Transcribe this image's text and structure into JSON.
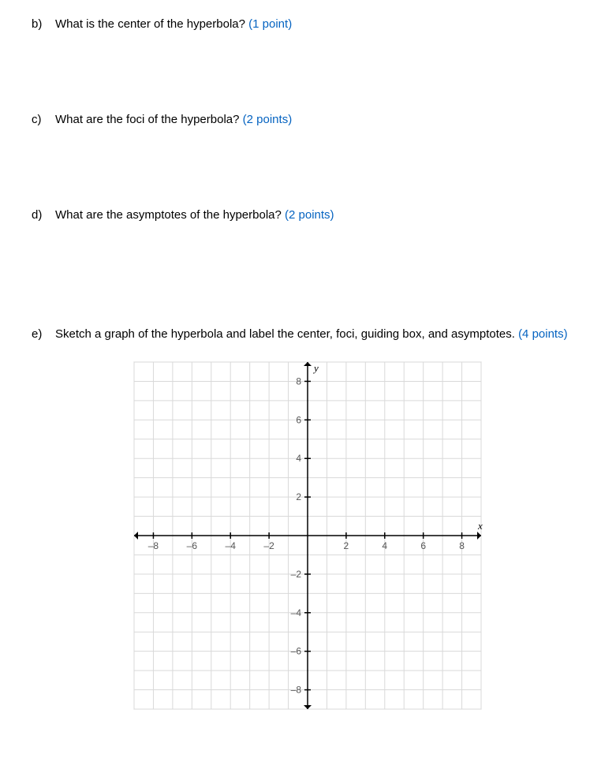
{
  "questions": [
    {
      "letter": "b)",
      "text": "What is the center of the hyperbola?",
      "points": "(1 point)"
    },
    {
      "letter": "c)",
      "text": "What are the foci of the hyperbola?",
      "points": "(2 points)"
    },
    {
      "letter": "d)",
      "text": "What are the asymptotes of the hyperbola?",
      "points": "(2 points)"
    },
    {
      "letter": "e)",
      "text": "Sketch a graph of the hyperbola and label the center, foci, guiding box, and asymptotes.",
      "points": "(4 points)"
    }
  ],
  "chart_data": {
    "type": "scatter",
    "title": "",
    "xlabel": "x",
    "ylabel": "y",
    "xlim": [
      -9,
      9
    ],
    "ylim": [
      -9,
      9
    ],
    "x_ticks": [
      -8,
      -6,
      -4,
      -2,
      2,
      4,
      6,
      8
    ],
    "y_ticks": [
      -8,
      -6,
      -4,
      -2,
      2,
      4,
      6,
      8
    ],
    "grid": true,
    "series": []
  }
}
